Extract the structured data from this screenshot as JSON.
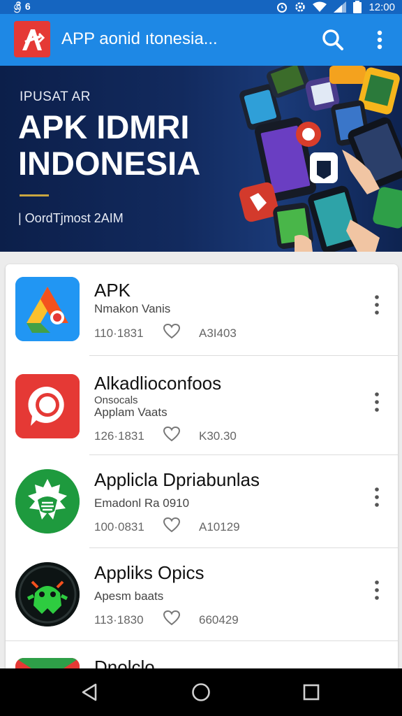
{
  "status_bar": {
    "left": "ශ්‍රී 6",
    "time": "12:00"
  },
  "app_bar": {
    "title": "APP aonid ıtonesia..."
  },
  "banner": {
    "kicker": "IPUSAT AR",
    "title_line1": "APK IDMRI",
    "title_line2": "INDONESIA",
    "subtitle": "| OordTjmost 2AIM"
  },
  "apps": [
    {
      "name": "APK",
      "category": "Nmakon Vanis",
      "category2": "",
      "size": "110·1831",
      "count": "A3I403",
      "icon": "drive-like-icon"
    },
    {
      "name": "Alkadlioconfoos",
      "category": "Onsocals",
      "category2": "Applam Vaats",
      "size": "126·1831",
      "count": "K30.30",
      "icon": "chat-bubble-icon"
    },
    {
      "name": "Applicla Dpriabunlas",
      "category": "Emadonl Ra 0910",
      "category2": "",
      "size": "100·0831",
      "count": "A10129",
      "icon": "green-emblem-icon"
    },
    {
      "name": "Appliks Opics",
      "category": "Apesm baats",
      "category2": "",
      "size": "113·1830",
      "count": "660429",
      "icon": "android-robot-icon"
    },
    {
      "name": "Dnolclo",
      "category": "",
      "category2": "",
      "size": "",
      "count": "",
      "icon": "partial-app-icon"
    }
  ],
  "colors": {
    "app_bar": "#1e88e5",
    "status_bar": "#1565c0",
    "banner": "#122a5e",
    "accent_red": "#e53935"
  }
}
